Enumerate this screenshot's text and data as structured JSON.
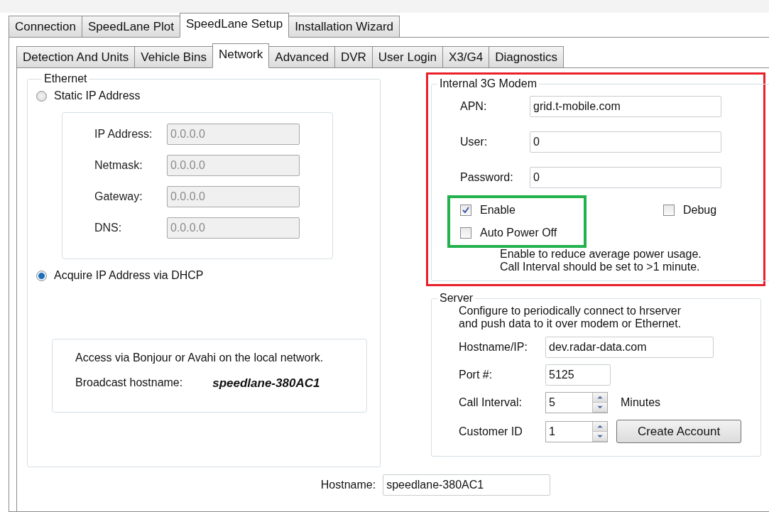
{
  "outer_tabs": [
    {
      "label": "Connection",
      "selected": false
    },
    {
      "label": "SpeedLane Plot",
      "selected": false
    },
    {
      "label": "SpeedLane Setup",
      "selected": true
    },
    {
      "label": "Installation Wizard",
      "selected": false
    }
  ],
  "inner_tabs": [
    {
      "label": "Detection And Units",
      "selected": false
    },
    {
      "label": "Vehicle Bins",
      "selected": false
    },
    {
      "label": "Network",
      "selected": true
    },
    {
      "label": "Advanced",
      "selected": false
    },
    {
      "label": "DVR",
      "selected": false
    },
    {
      "label": "User Login",
      "selected": false
    },
    {
      "label": "X3/G4",
      "selected": false
    },
    {
      "label": "Diagnostics",
      "selected": false
    }
  ],
  "ethernet": {
    "title": "Ethernet",
    "modes": [
      {
        "label": "Static IP Address",
        "selected": false
      },
      {
        "label": "Acquire IP Address via DHCP",
        "selected": true
      }
    ],
    "static_fields": [
      {
        "label": "IP Address:",
        "value": "0.0.0.0",
        "disabled": true
      },
      {
        "label": "Netmask:",
        "value": "0.0.0.0",
        "disabled": true
      },
      {
        "label": "Gateway:",
        "value": "0.0.0.0",
        "disabled": true
      },
      {
        "label": "DNS:",
        "value": "0.0.0.0",
        "disabled": true
      }
    ],
    "bonjour": {
      "note": "Access via Bonjour or Avahi on the local network.",
      "broadcast_label": "Broadcast hostname:",
      "broadcast_value": "speedlane-380AC1"
    }
  },
  "modem": {
    "title": "Internal 3G Modem",
    "highlighted": true,
    "fields": [
      {
        "label": "APN:",
        "value": "grid.t-mobile.com"
      },
      {
        "label": "User:",
        "value": "0"
      },
      {
        "label": "Password:",
        "value": "0"
      }
    ],
    "option_groups": [
      {
        "highlighted": true,
        "items": [
          {
            "label": "Enable",
            "checked": true
          },
          {
            "label": "Auto Power Off",
            "checked": false
          }
        ]
      },
      {
        "highlighted": false,
        "items": [
          {
            "label": "Debug",
            "checked": false
          }
        ]
      }
    ],
    "note_lines": [
      "Enable to reduce average power usage.",
      "Call Interval should be set to >1 minute."
    ]
  },
  "server": {
    "title": "Server",
    "description_lines": [
      "Configure to periodically connect to hrserver",
      "and push data to it over modem or Ethernet."
    ],
    "fields": [
      {
        "kind": "text",
        "label": "Hostname/IP:",
        "value": "dev.radar-data.com"
      },
      {
        "kind": "text",
        "label": "Port #:",
        "value": "5125"
      },
      {
        "kind": "spinner",
        "label": "Call Interval:",
        "value": "5",
        "unit": "Minutes"
      },
      {
        "kind": "spinner",
        "label": "Customer ID",
        "value": "1",
        "button": "Create Account"
      }
    ]
  },
  "hostname": {
    "label": "Hostname:",
    "value": "speedlane-380AC1"
  }
}
